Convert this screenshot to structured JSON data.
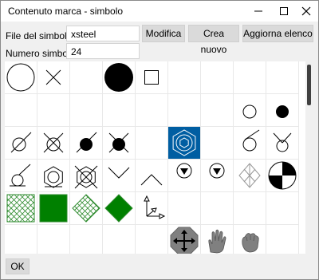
{
  "window": {
    "title": "Contenuto marca - simbolo"
  },
  "form": {
    "file_label": "File del simbolo:",
    "file_value": "xsteel",
    "number_label": "Numero simbolo:",
    "number_value": "24"
  },
  "buttons": {
    "modify": "Modifica",
    "create": "Crea nuovo",
    "refresh": "Aggiorna elenco",
    "ok": "OK"
  },
  "icons": {
    "minimize": "minimize-icon",
    "maximize": "maximize-icon",
    "close": "close-icon"
  },
  "colors": {
    "selected_cell": "#005ea2",
    "green": "#008000",
    "hatch": "#2e8b2e",
    "gray_symbol": "#808080"
  },
  "symbols": [
    [
      "circle-large",
      "x-cross",
      "empty",
      "filled-circle-large",
      "square",
      "empty",
      "empty",
      "empty",
      "empty"
    ],
    [
      "empty",
      "empty",
      "empty",
      "empty",
      "empty",
      "empty",
      "empty",
      "circle-small",
      "filled-circle-small"
    ],
    [
      "circle-slash",
      "circle-double-slash",
      "filled-circle-slash",
      "filled-circle-double-slash",
      "empty",
      "hexagon-nut-selected",
      "empty",
      "circle-slash-right",
      "circle-double-slash-v"
    ],
    [
      "circle-pin",
      "hexagon-pin",
      "hexagon-double-slash",
      "chevron-down",
      "chevron-up",
      "circle-triangle-down",
      "circle-triangle-down-2",
      "diamond-outline",
      "quarter-circle"
    ],
    [
      "hatch-square",
      "green-square",
      "hatch-diamond",
      "green-diamond",
      "axes",
      "empty",
      "empty",
      "empty",
      "empty"
    ],
    [
      "empty",
      "empty",
      "empty",
      "empty",
      "empty",
      "move-octagon",
      "hand-open",
      "hand-grab",
      "empty"
    ]
  ]
}
